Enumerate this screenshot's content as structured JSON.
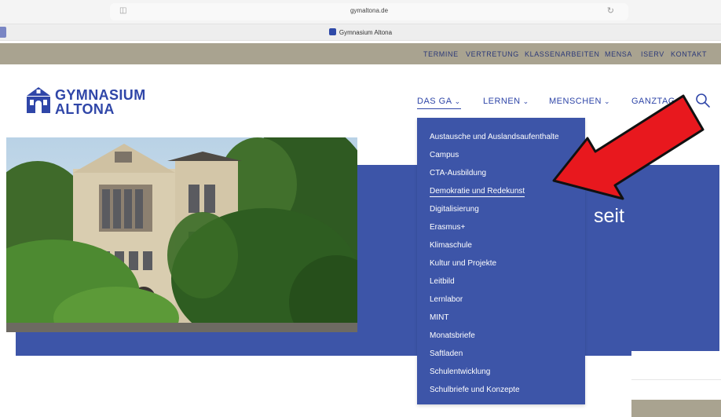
{
  "browser": {
    "url": "gymaltona.de",
    "tab_title": "Gymnasium Altona"
  },
  "utility_nav": [
    "TERMINE",
    "VERTRETUNG",
    "KLASSENARBEITEN",
    "MENSA",
    "ISERV",
    "KONTAKT"
  ],
  "logo": {
    "line1": "GYMNASIUM",
    "line2": "ALTONA"
  },
  "main_nav": [
    {
      "label": "DAS GA",
      "active": true
    },
    {
      "label": "LERNEN"
    },
    {
      "label": "MENSCHEN"
    },
    {
      "label": "GANZTAG"
    }
  ],
  "dropdown_items": [
    "Austausche und Auslandsaufenthalte",
    "Campus",
    "CTA-Ausbildung",
    "Demokratie und Redekunst",
    "Digitalisierung",
    "Erasmus+",
    "Klimaschule",
    "Kultur und Projekte",
    "Leitbild",
    "Lernlabor",
    "MINT",
    "Monatsbriefe",
    "Saftladen",
    "Schulentwicklung",
    "Schulbriefe und Konzepte"
  ],
  "hero": {
    "text_visible": "seit",
    "paren_visible": ")"
  },
  "colors": {
    "brand_blue": "#3d55a8",
    "nav_blue": "#2f46a8",
    "topbar_bg": "#a9a390",
    "annotation_arrow": "#e8181e"
  },
  "annotation": "red-arrow pointing at Demokratie und Redekunst"
}
